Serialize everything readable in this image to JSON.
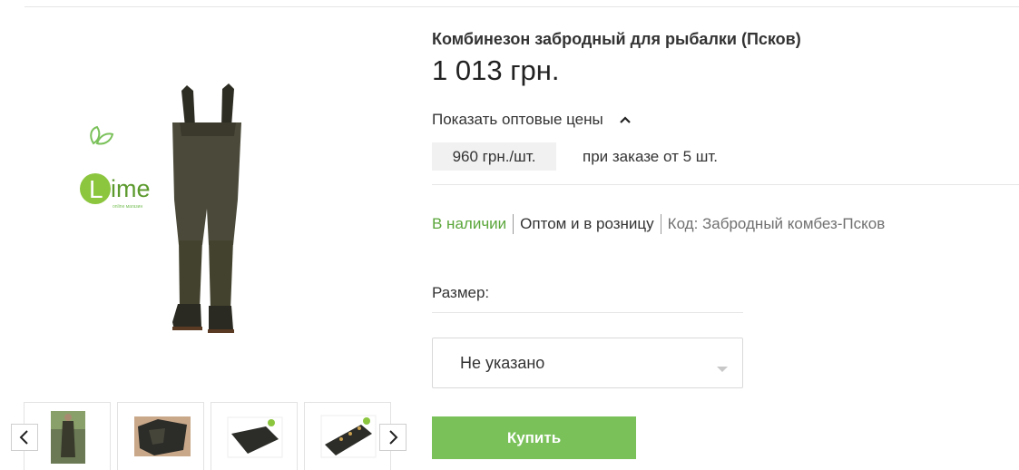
{
  "product": {
    "title": "Комбинезон забродный для рыбалки (Псков)",
    "price": "1 013 грн.",
    "wholesale_toggle": "Показать оптовые цены",
    "wholesale_price": "960 грн./шт.",
    "wholesale_condition": "при заказе от 5 шт.",
    "availability": "В наличии",
    "sale_type": "Оптом и в розницу",
    "code": "Код: Забродный комбез-Псков"
  },
  "options": {
    "size_label": "Размер:",
    "size_value": "Не указано"
  },
  "actions": {
    "buy_label": "Купить"
  },
  "gallery": {
    "logo_text": "Lime",
    "logo_sub": "online магазин",
    "thumbnail_count": 4
  },
  "colors": {
    "accent_green": "#7ac15a",
    "in_stock_green": "#5aa63a",
    "wader_olive": "#4b4a3a"
  },
  "icons": {
    "prev": "chevron-left-icon",
    "next": "chevron-right-icon",
    "toggle": "chevron-up-icon",
    "select": "caret-down-icon"
  }
}
